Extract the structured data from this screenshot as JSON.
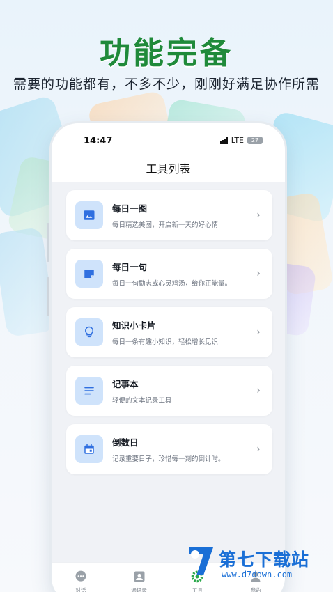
{
  "promo": {
    "headline": "功能完备",
    "subline": "需要的功能都有，不多不少，刚刚好满足协作所需"
  },
  "status_bar": {
    "time": "14:47",
    "network": "LTE",
    "battery": "27"
  },
  "page": {
    "title": "工具列表"
  },
  "tools": [
    {
      "name": "每日一图",
      "desc": "每日精选美图，开启新一天的好心情",
      "icon": "image-icon"
    },
    {
      "name": "每日一句",
      "desc": "每日一句励志或心灵鸡汤，给你正能量。",
      "icon": "note-icon"
    },
    {
      "name": "知识小卡片",
      "desc": "每日一条有趣小知识，轻松增长见识",
      "icon": "lightbulb-icon"
    },
    {
      "name": "记事本",
      "desc": "轻便的文本记录工具",
      "icon": "notes-icon"
    },
    {
      "name": "倒数日",
      "desc": "记录重要日子，珍惜每一刻的倒计时。",
      "icon": "calendar-icon"
    }
  ],
  "tabbar": {
    "items": [
      {
        "label": "对话",
        "icon": "chat-icon"
      },
      {
        "label": "通讯录",
        "icon": "contacts-icon"
      },
      {
        "label": "工具",
        "icon": "gear-icon"
      },
      {
        "label": "我的",
        "icon": "user-icon"
      }
    ]
  },
  "watermark": {
    "text": "第七下载站",
    "url": "www.d7down.com"
  },
  "colors": {
    "headline": "#1f8a3a",
    "accent": "#1a6fd6",
    "icon_bg": "#cfe3fb",
    "icon_fg": "#2f6fe0"
  }
}
